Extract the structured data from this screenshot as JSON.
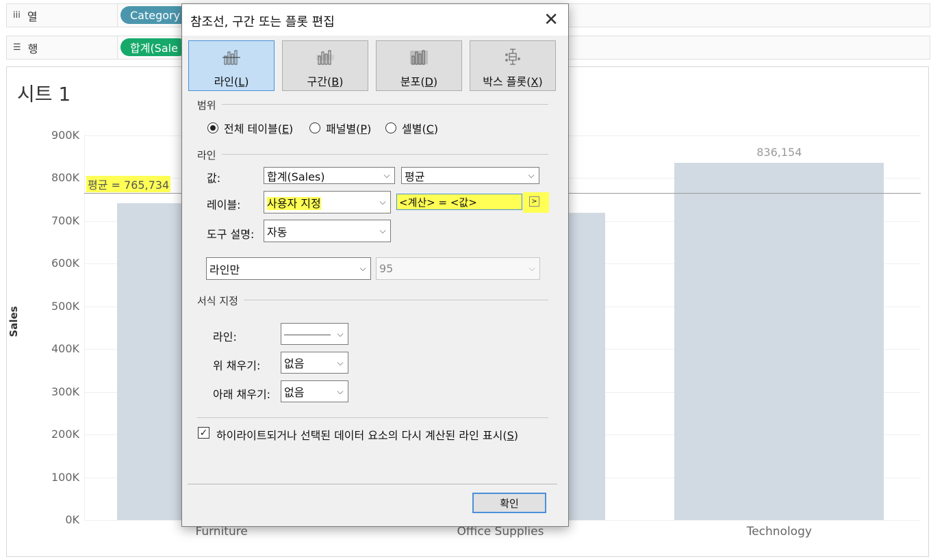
{
  "shelves": {
    "columns": {
      "icon": "columns-icon",
      "label": "열",
      "pill": "Category"
    },
    "rows": {
      "icon": "rows-icon",
      "label": "행",
      "pill": "합계(Sale"
    }
  },
  "sheet": {
    "title": "시트 1",
    "chart_data": {
      "type": "bar",
      "categories": [
        "Furniture",
        "Office Supplies",
        "Technology"
      ],
      "values": [
        741718,
        719047,
        836154
      ],
      "ylabel": "Sales",
      "ylim": [
        0,
        900000
      ],
      "yticks": [
        "900K",
        "800K",
        "700K",
        "600K",
        "500K",
        "400K",
        "300K",
        "200K",
        "100K",
        "0K"
      ],
      "data_labels": {
        "Technology": "836,154"
      },
      "reference_line": {
        "value": 765734,
        "label": "평균 = 765,734"
      },
      "bar_color": "#d1dae3",
      "highlight_color": "#ffff55"
    }
  },
  "dialog": {
    "title": "참조선, 구간 또는 플롯 편집",
    "close_icon": "close-icon",
    "tabs": [
      {
        "label": "라인",
        "key": "L",
        "active": true
      },
      {
        "label": "구간",
        "key": "B",
        "active": false
      },
      {
        "label": "분포",
        "key": "D",
        "active": false
      },
      {
        "label": "박스 플롯",
        "key": "X",
        "active": false
      }
    ],
    "scope": {
      "label": "범위",
      "options": [
        {
          "label": "전체 테이블",
          "key": "E",
          "selected": true
        },
        {
          "label": "패널별",
          "key": "P",
          "selected": false
        },
        {
          "label": "셀별",
          "key": "C",
          "selected": false
        }
      ]
    },
    "line": {
      "label": "라인",
      "value_label": "값:",
      "value_field": "합계(Sales)",
      "value_agg": "평균",
      "label_label": "레이블:",
      "label_select": "사용자 지정",
      "label_input": "<계산> = <값>",
      "arrow_button": ">",
      "tooltip_label": "도구 설명:",
      "tooltip_select": "자동",
      "line_type": "라인만",
      "confidence": "95"
    },
    "format": {
      "label": "서식 지정",
      "line_label": "라인:",
      "fill_above_label": "위 채우기:",
      "fill_above": "없음",
      "fill_below_label": "아래 채우기:",
      "fill_below": "없음"
    },
    "recalc_checkbox": {
      "label": "하이라이트되거나 선택된 데이터 요소의 다시 계산된 라인 표시",
      "key": "S",
      "checked": true
    },
    "ok_label": "확인"
  }
}
